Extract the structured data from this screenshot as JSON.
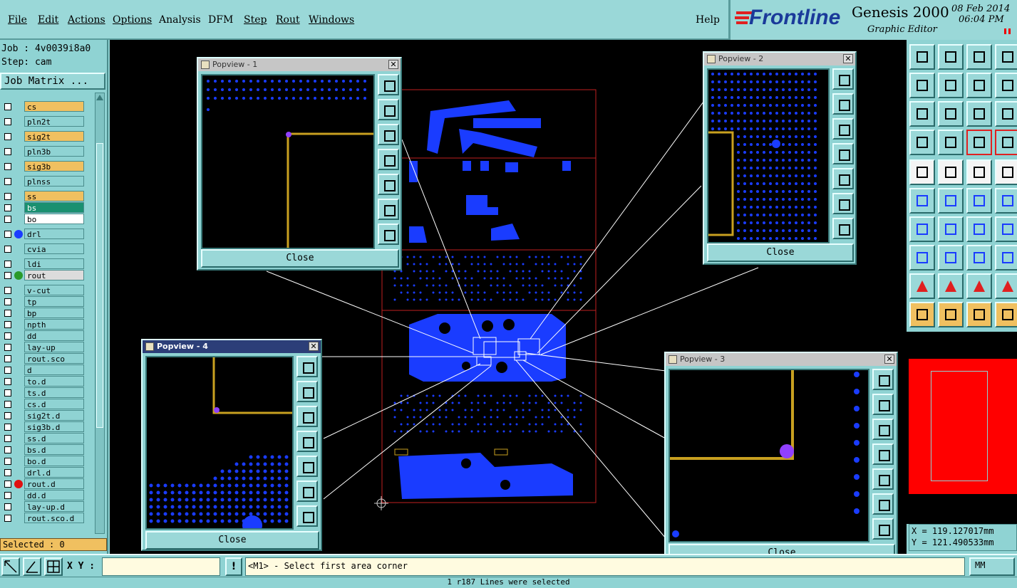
{
  "menu": {
    "items": [
      "File",
      "Edit",
      "Actions",
      "Options",
      "Analysis",
      "DFM",
      "Step",
      "Rout",
      "Windows"
    ],
    "help": "Help"
  },
  "brand": {
    "logo": "Frontline",
    "product": "Genesis 2000",
    "subtitle": "Graphic Editor",
    "date": "08 Feb 2014",
    "time": "06:04 PM"
  },
  "job": {
    "job_line": "Job : 4v0039i8a0",
    "step_line": "Step: cam",
    "job_matrix_label": "Job Matrix ..."
  },
  "layers": [
    {
      "name": "cs",
      "color": "#f0c060",
      "dot": null
    },
    {
      "name": "pln2t",
      "color": "#8fd3d3",
      "dot": null
    },
    {
      "name": "sig2t",
      "color": "#f0c060",
      "dot": null
    },
    {
      "name": "pln3b",
      "color": "#8fd3d3",
      "dot": null
    },
    {
      "name": "sig3b",
      "color": "#f0c060",
      "dot": null
    },
    {
      "name": "plnss",
      "color": "#8fd3d3",
      "dot": null
    },
    {
      "name": "ss",
      "color": "#f0c060",
      "dot": null
    },
    {
      "name": "bs",
      "color": "#1a9070",
      "dot": null
    },
    {
      "name": "bo",
      "color": "#ffffff",
      "dot": null
    },
    {
      "name": "drl",
      "color": "#8fd3d3",
      "dot": "#1a3cff"
    },
    {
      "name": "cvia",
      "color": "#8fd3d3",
      "dot": null
    },
    {
      "name": "ldi",
      "color": "#8fd3d3",
      "dot": null
    },
    {
      "name": "rout",
      "color": "#dcdcdc",
      "dot": "#2a9a2a"
    },
    {
      "name": "v-cut",
      "color": "#8fd3d3",
      "dot": null
    },
    {
      "name": "tp",
      "color": "#8fd3d3",
      "dot": null
    },
    {
      "name": "bp",
      "color": "#8fd3d3",
      "dot": null
    },
    {
      "name": "npth",
      "color": "#8fd3d3",
      "dot": null
    },
    {
      "name": "dd",
      "color": "#8fd3d3",
      "dot": null
    },
    {
      "name": "lay-up",
      "color": "#8fd3d3",
      "dot": null
    },
    {
      "name": "rout.sco",
      "color": "#8fd3d3",
      "dot": null
    },
    {
      "name": "d",
      "color": "#8fd3d3",
      "dot": null
    },
    {
      "name": "to.d",
      "color": "#8fd3d3",
      "dot": null
    },
    {
      "name": "ts.d",
      "color": "#8fd3d3",
      "dot": null
    },
    {
      "name": "cs.d",
      "color": "#8fd3d3",
      "dot": null
    },
    {
      "name": "sig2t.d",
      "color": "#8fd3d3",
      "dot": null
    },
    {
      "name": "sig3b.d",
      "color": "#8fd3d3",
      "dot": null
    },
    {
      "name": "ss.d",
      "color": "#8fd3d3",
      "dot": null
    },
    {
      "name": "bs.d",
      "color": "#8fd3d3",
      "dot": null
    },
    {
      "name": "bo.d",
      "color": "#8fd3d3",
      "dot": null
    },
    {
      "name": "drl.d",
      "color": "#8fd3d3",
      "dot": null
    },
    {
      "name": "rout.d",
      "color": "#8fd3d3",
      "dot": "#e01010"
    },
    {
      "name": "dd.d",
      "color": "#8fd3d3",
      "dot": null
    },
    {
      "name": "lay-up.d",
      "color": "#8fd3d3",
      "dot": null
    },
    {
      "name": "rout.sco.d",
      "color": "#8fd3d3",
      "dot": null
    }
  ],
  "selected": "Selected : 0",
  "popviews": [
    {
      "title": "Popview - 1",
      "close": "Close"
    },
    {
      "title": "Popview - 2",
      "close": "Close"
    },
    {
      "title": "Popview - 3",
      "close": "Close"
    },
    {
      "title": "Popview - 4",
      "close": "Close"
    }
  ],
  "coords": {
    "x": "X = 119.127017mm",
    "y": "Y = 121.490533mm"
  },
  "bottom": {
    "xy_label": "X Y :",
    "xy_value": "",
    "prompt": "<M1> - Select first area corner",
    "units": "MM",
    "status": "1 r187 Lines were selected"
  },
  "colors": {
    "pcb_blue": "#1a3cff",
    "trace_gold": "#c8a020",
    "accent_red": "#ff0000",
    "panel": "#8fd3d3"
  }
}
